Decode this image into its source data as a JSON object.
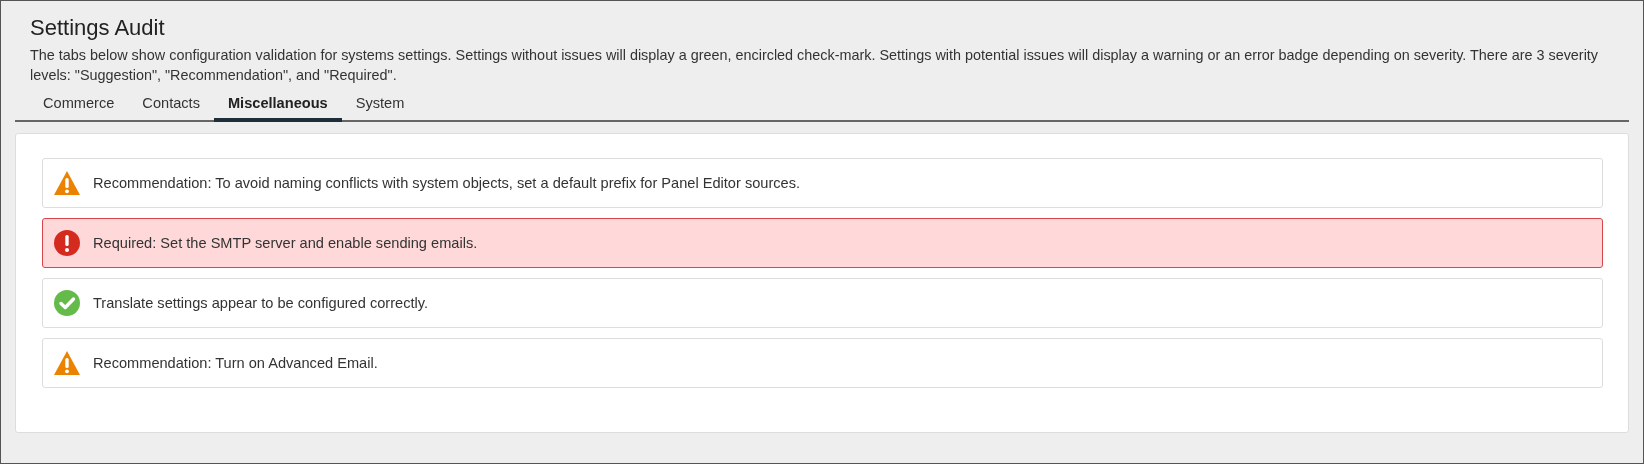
{
  "header": {
    "title": "Settings Audit",
    "description": "The tabs below show configuration validation for systems settings. Settings without issues will display a green, encircled check-mark. Settings with potential issues will display a warning or an error badge depending on severity. There are 3 severity levels: \"Suggestion\", \"Recommendation\", and \"Required\"."
  },
  "tabs": [
    {
      "label": "Commerce",
      "selected": false
    },
    {
      "label": "Contacts",
      "selected": false
    },
    {
      "label": "Miscellaneous",
      "selected": true
    },
    {
      "label": "System",
      "selected": false
    }
  ],
  "results": [
    {
      "kind": "warning",
      "text": "Recommendation: To avoid naming conflicts with system objects, set a default prefix for Panel Editor sources."
    },
    {
      "kind": "error",
      "text": "Required: Set the SMTP server and enable sending emails."
    },
    {
      "kind": "success",
      "text": "Translate settings appear to be configured correctly."
    },
    {
      "kind": "warning",
      "text": "Recommendation: Turn on Advanced Email."
    }
  ]
}
